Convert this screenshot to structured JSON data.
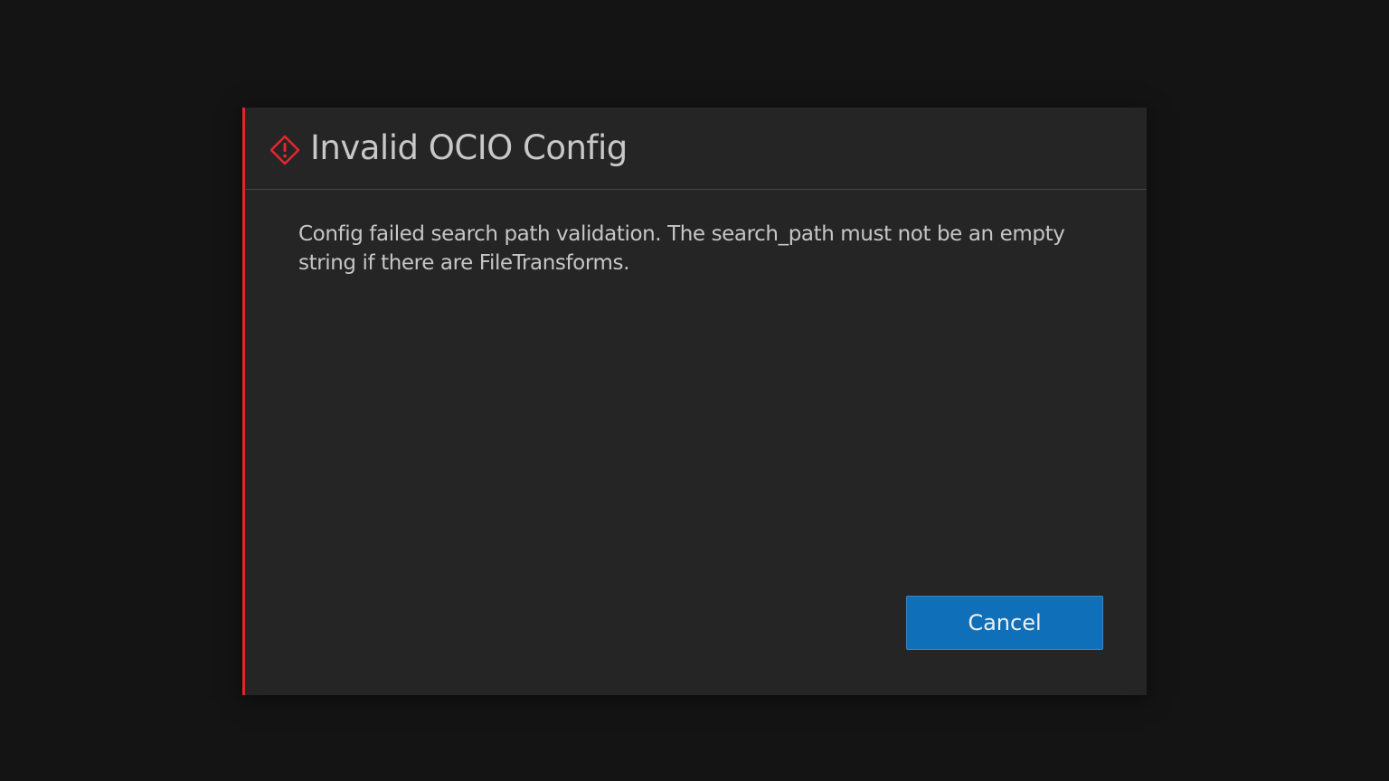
{
  "dialog": {
    "title": "Invalid OCIO Config",
    "icon": "alert-diamond-icon",
    "message": "Config failed search path validation. The search_path must not be an empty string if there are FileTransforms.",
    "cancel_label": "Cancel"
  },
  "colors": {
    "background": "#141414",
    "dialog_background": "#252525",
    "accent_error": "#e3262e",
    "button_primary": "#0f6fb8",
    "text": "#c6c6c6"
  }
}
